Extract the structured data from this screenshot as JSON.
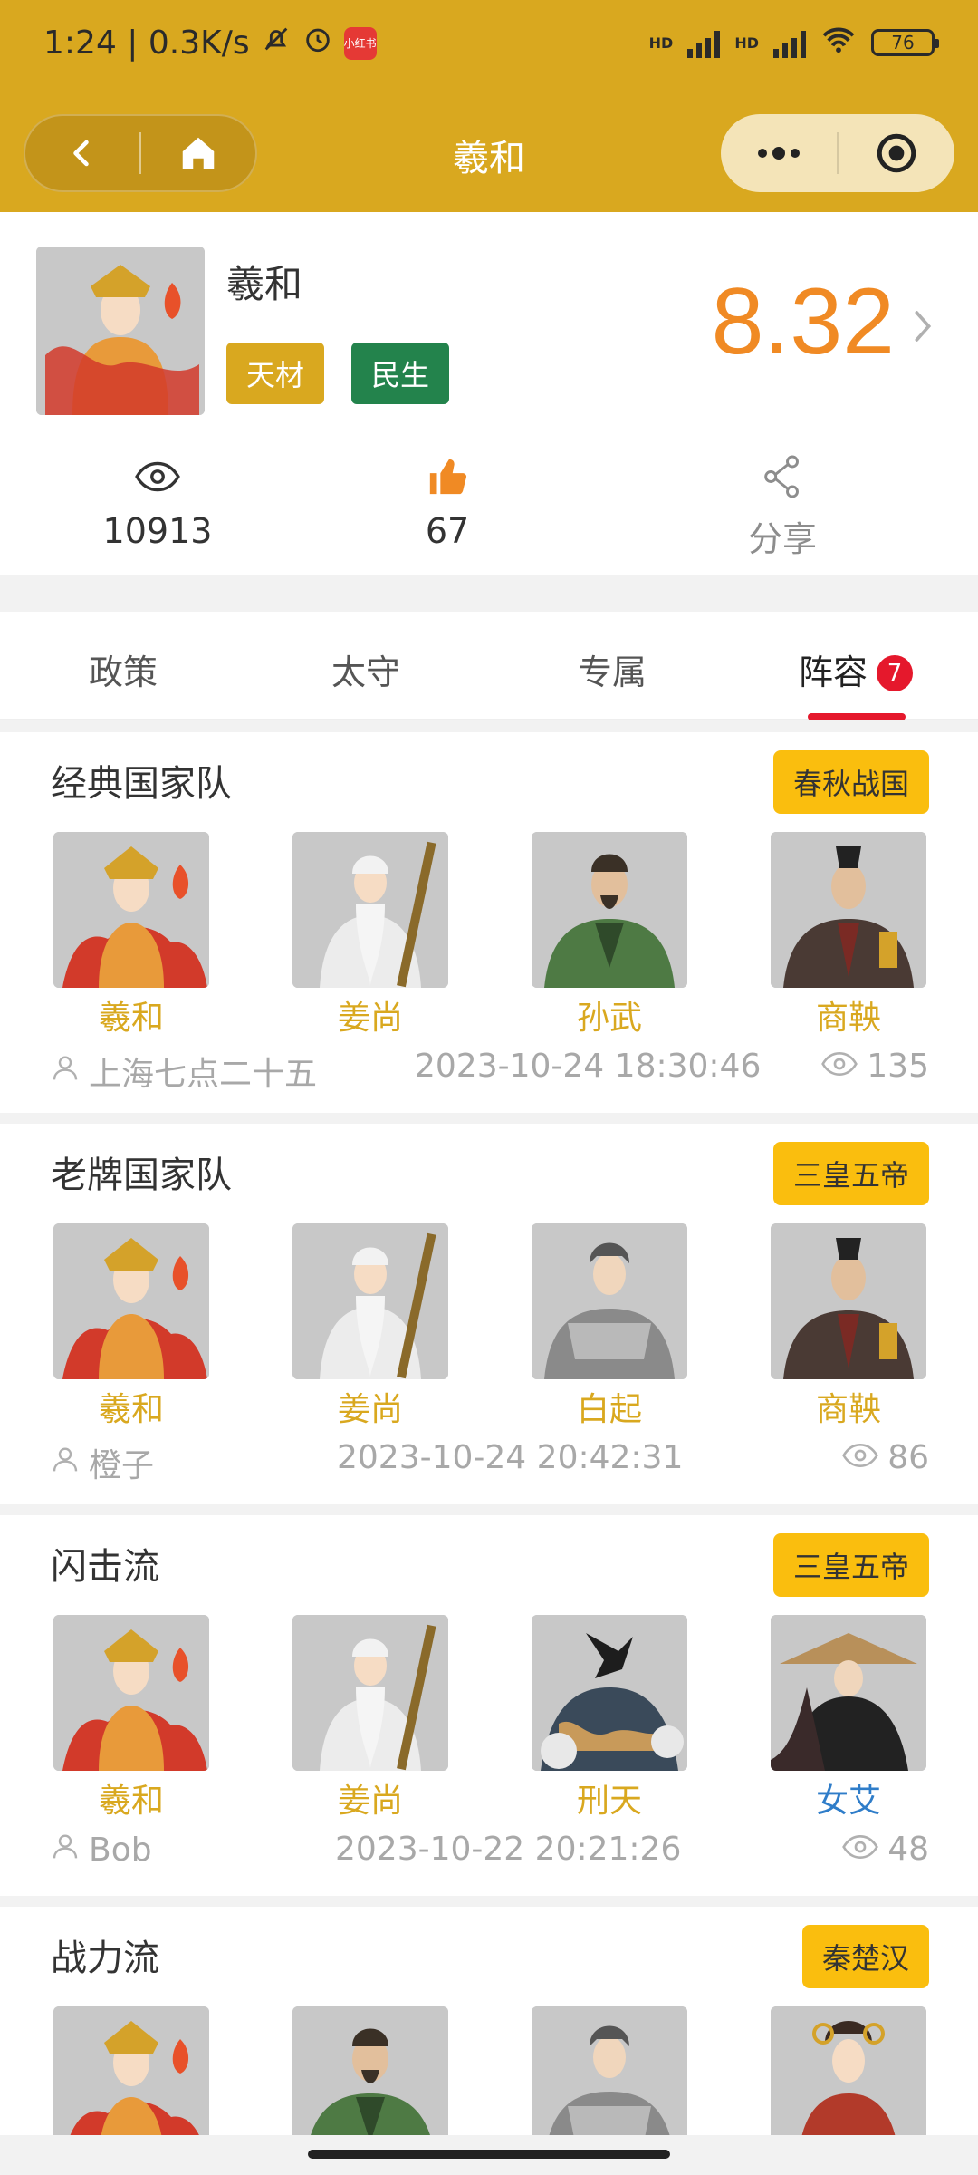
{
  "status_bar": {
    "time_speed": "1:24 | 0.3K/s",
    "battery": "76",
    "hd1": "HD",
    "hd2": "HD",
    "app_badge": "小红书"
  },
  "nav": {
    "title": "羲和"
  },
  "profile": {
    "name": "羲和",
    "tags": [
      "天材",
      "民生"
    ],
    "score": "8.32",
    "views": "10913",
    "likes": "67",
    "share": "分享"
  },
  "tabs": {
    "items": [
      "政策",
      "太守",
      "专属",
      "阵容"
    ],
    "badge": "7",
    "active": 3
  },
  "cards": [
    {
      "title": "经典国家队",
      "tag": "春秋战国",
      "heroes": [
        "羲和",
        "姜尚",
        "孙武",
        "商鞅"
      ],
      "author": "上海七点二十五",
      "time": "2023-10-24 18:30:46",
      "views": "135"
    },
    {
      "title": "老牌国家队",
      "tag": "三皇五帝",
      "heroes": [
        "羲和",
        "姜尚",
        "白起",
        "商鞅"
      ],
      "author": "橙子",
      "time": "2023-10-24 20:42:31",
      "views": "86"
    },
    {
      "title": "闪击流",
      "tag": "三皇五帝",
      "heroes": [
        "羲和",
        "姜尚",
        "刑天",
        "女艾"
      ],
      "author": "Bob",
      "time": "2023-10-22 20:21:26",
      "views": "48"
    },
    {
      "title": "战力流",
      "tag": "秦楚汉",
      "heroes": [
        "羲和",
        "",
        "",
        ""
      ]
    }
  ],
  "colors": {
    "gold": "#D9A81F",
    "orange": "#F08A24",
    "green": "#23834C",
    "tag_yellow": "#FABE0E",
    "red": "#e5182c",
    "blue_name": "#2F7DC9"
  }
}
